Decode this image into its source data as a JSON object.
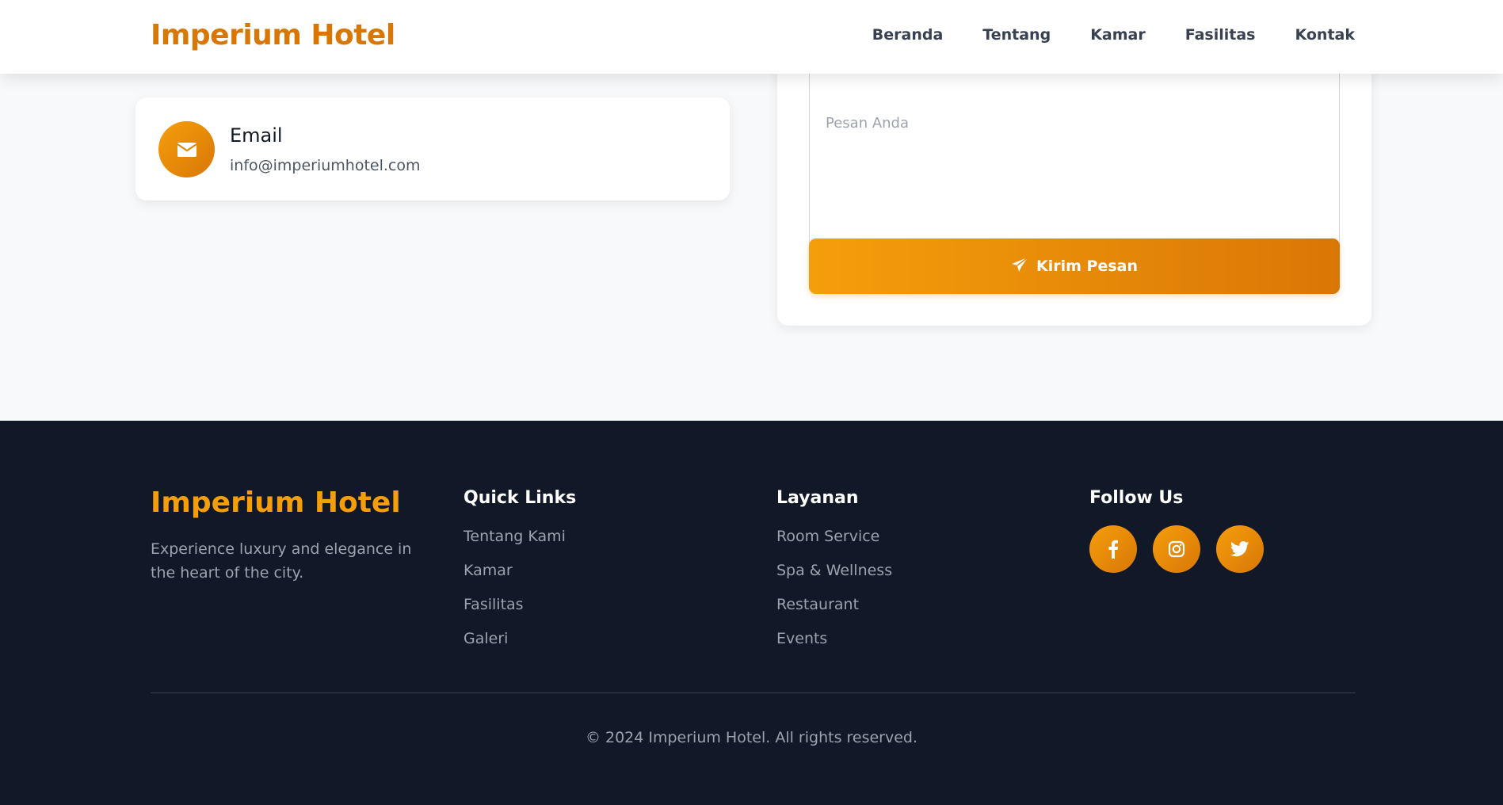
{
  "header": {
    "brand": "Imperium Hotel",
    "nav": [
      "Beranda",
      "Tentang",
      "Kamar",
      "Fasilitas",
      "Kontak"
    ]
  },
  "contact": {
    "email_title": "Email",
    "email_value": "info@imperiumhotel.com",
    "message_placeholder": "Pesan Anda",
    "send_label": "Kirim Pesan"
  },
  "footer": {
    "brand": "Imperium Hotel",
    "description": "Experience luxury and elegance in the heart of the city.",
    "quick_links": {
      "title": "Quick Links",
      "items": [
        "Tentang Kami",
        "Kamar",
        "Fasilitas",
        "Galeri"
      ]
    },
    "services": {
      "title": "Layanan",
      "items": [
        "Room Service",
        "Spa & Wellness",
        "Restaurant",
        "Events"
      ]
    },
    "follow": {
      "title": "Follow Us",
      "icons": [
        "facebook-icon",
        "instagram-icon",
        "twitter-icon"
      ]
    },
    "copyright": "© 2024 Imperium Hotel. All rights reserved."
  },
  "colors": {
    "accent": "#f59e0b",
    "accent_dark": "#d97706",
    "footer_bg": "#111827",
    "page_bg": "#f8f9fb"
  }
}
